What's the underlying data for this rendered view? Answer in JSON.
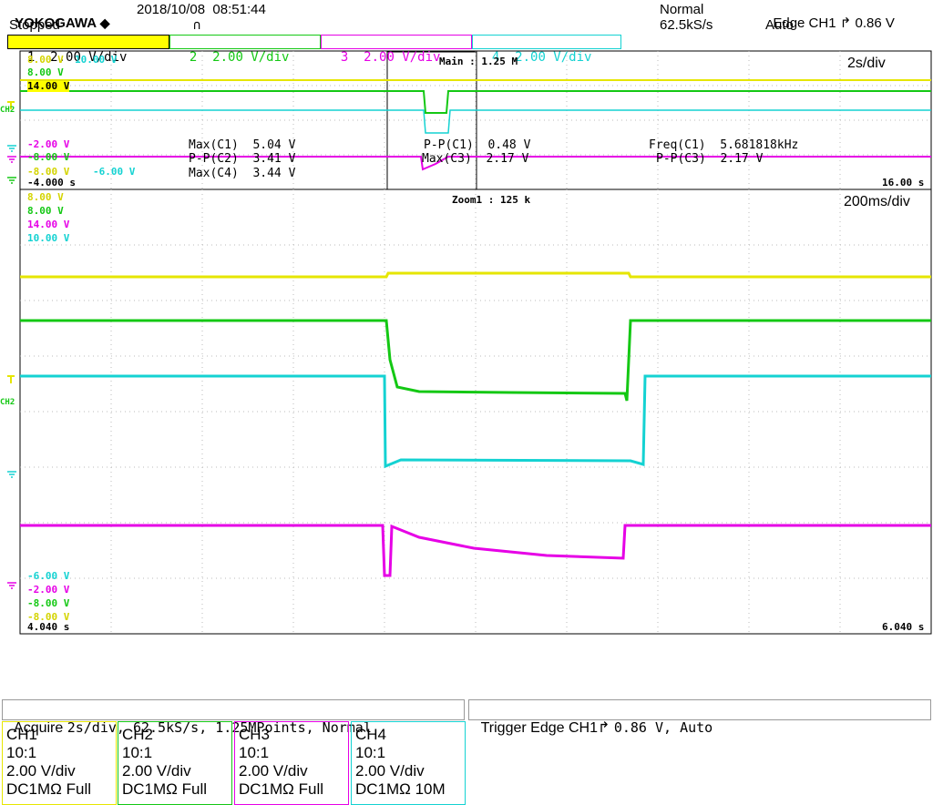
{
  "header": {
    "brand": "YOKOGAWA",
    "datetime": "2018/10/08  08:51:44",
    "status": "Stopped",
    "trig_mode": "Normal",
    "sample_rate": "62.5kS/s",
    "trigger_summary": "Edge CH1",
    "trigger_level": "0.86 V",
    "trigger_run": "Auto"
  },
  "channel_tabs": [
    {
      "num": "1",
      "scale": "2.00 V",
      "unit": "/div",
      "color": "#ffff00",
      "text": "#000000"
    },
    {
      "num": "2",
      "scale": "2.00 V",
      "unit": "/div",
      "color": "#ffffff",
      "text": "#14c814"
    },
    {
      "num": "3",
      "scale": "2.00 V",
      "unit": "/div",
      "color": "#ffffff",
      "text": "#e600e6"
    },
    {
      "num": "4",
      "scale": "2.00 V",
      "unit": "/div",
      "color": "#ffffff",
      "text": "#14d2d2"
    }
  ],
  "main_panel": {
    "label": "Main : 1.25 M",
    "timebase": "2s/div",
    "t_start": "-4.000 s",
    "t_end": "16.00 s",
    "upper_labels": {
      "ch1": "8.00 V",
      "ch2": "8.00 V",
      "ch3": "14.00 V",
      "ch4": "10.00 V"
    },
    "lower_labels": {
      "ch1": "-8.00 V",
      "ch2": "-2.00 V",
      "ch3": "-8.00 V",
      "ch4": "-6.00 V"
    },
    "measurements": {
      "max_c1": "Max(C1)  5.04 V",
      "pp_c2": "P-P(C2)  3.41 V",
      "max_c4": "Max(C4)  3.44 V",
      "pp_c1": "P-P(C1)  0.48 V",
      "max_c3": "Max(C3)  2.17 V",
      "freq_c1": "Freq(C1)  5.681818kHz",
      "pp_c3": "P-P(C3)  2.17 V"
    }
  },
  "zoom_panel": {
    "label": "Zoom1 : 125 k",
    "timebase": "200ms/div",
    "t_start": "4.040 s",
    "t_end": "6.040 s",
    "upper_labels": {
      "ch1": "8.00 V",
      "ch2": "8.00 V",
      "ch3": "14.00 V",
      "ch4": "10.00 V"
    },
    "lower_labels": {
      "ch4": "-6.00 V",
      "ch2": "-2.00 V",
      "ch3": "-8.00 V",
      "ch1": "-8.00 V"
    }
  },
  "ch2_marker": "CH2",
  "acquire": {
    "label": "Acquire",
    "value": "2s/div, 62.5kS/s, 1.25MPoints, Normal"
  },
  "trigger": {
    "label": "Trigger",
    "value": "Edge CH1",
    "level": "0.86 V, Auto"
  },
  "channels": [
    {
      "name": "CH1",
      "probe": "10:1",
      "scale": "2.00 V/div",
      "coupling": "DC1MΩ Full",
      "color": "#e6e600"
    },
    {
      "name": "CH2",
      "probe": "10:1",
      "scale": "2.00 V/div",
      "coupling": "DC1MΩ Full",
      "color": "#14c814"
    },
    {
      "name": "CH3",
      "probe": "10:1",
      "scale": "2.00 V/div",
      "coupling": "DC1MΩ Full",
      "color": "#e600e6"
    },
    {
      "name": "CH4",
      "probe": "10:1",
      "scale": "2.00 V/div",
      "coupling": "DC1MΩ 10M",
      "color": "#14d2d2"
    }
  ],
  "colors": {
    "ch1": "#e6e600",
    "ch2": "#14c814",
    "ch3": "#e600e6",
    "ch4": "#14d2d2",
    "grid": "#bbbbbb"
  }
}
